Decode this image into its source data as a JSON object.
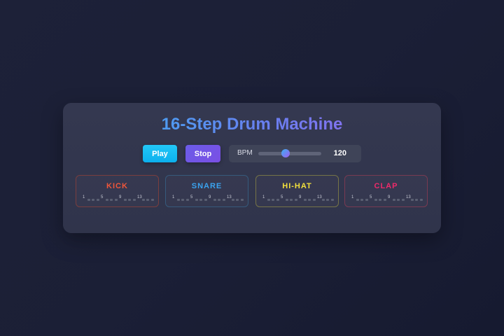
{
  "title": "16-Step Drum Machine",
  "controls": {
    "play_label": "Play",
    "stop_label": "Stop",
    "bpm_label": "BPM",
    "bpm_value": "120",
    "bpm_slider_fraction": 0.43
  },
  "tracks": [
    {
      "name": "KICK",
      "color": "#f0563a",
      "border": "#7a3e3e"
    },
    {
      "name": "SNARE",
      "color": "#3aa2ee",
      "border": "#365a7c"
    },
    {
      "name": "HI-HAT",
      "color": "#f3e03c",
      "border": "#767447"
    },
    {
      "name": "CLAP",
      "color": "#ee2a6a",
      "border": "#793a52"
    }
  ],
  "step_markers": [
    "1",
    "5",
    "9",
    "13"
  ]
}
